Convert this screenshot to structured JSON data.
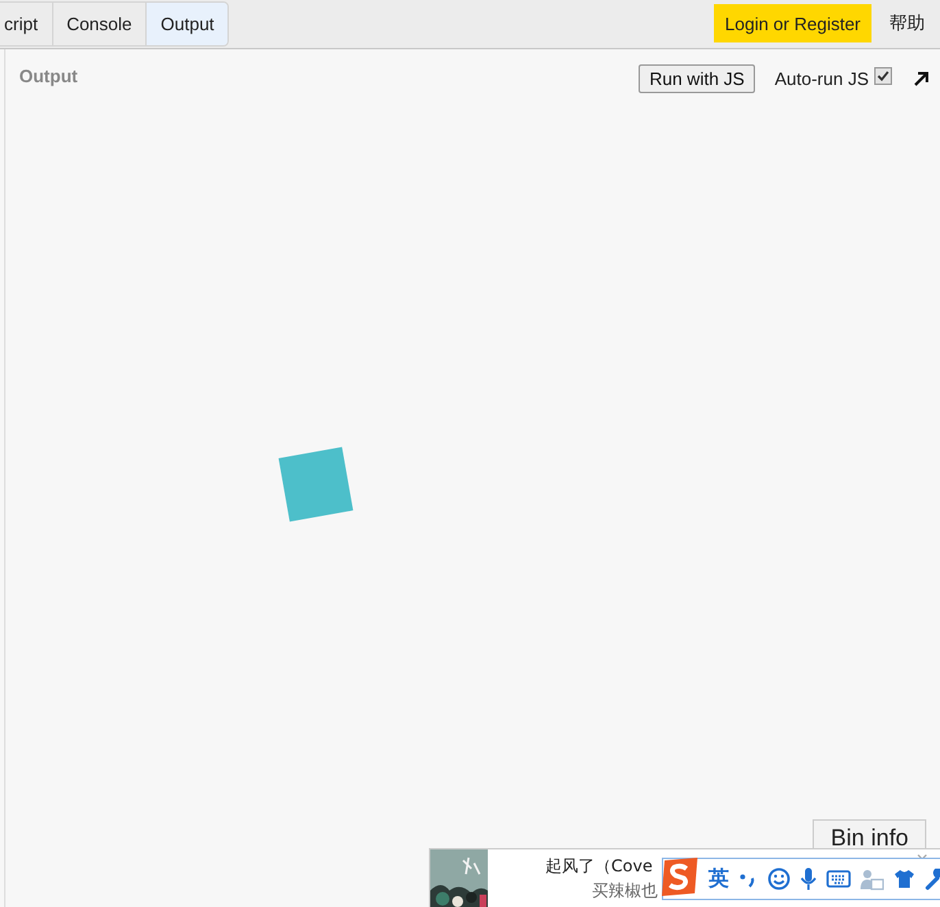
{
  "tabs": [
    {
      "label": "cript",
      "selected": false
    },
    {
      "label": "Console",
      "selected": false
    },
    {
      "label": "Output",
      "selected": true
    }
  ],
  "header": {
    "login": "Login or Register",
    "help": "帮助"
  },
  "output": {
    "title": "Output",
    "run_button": "Run with JS",
    "autorun": {
      "label": "Auto-run JS",
      "checked": true
    },
    "bin_info": "Bin info"
  },
  "notification": {
    "title": "起风了（Cove",
    "subtitle": "买辣椒也"
  },
  "ime": {
    "mode": "英"
  }
}
